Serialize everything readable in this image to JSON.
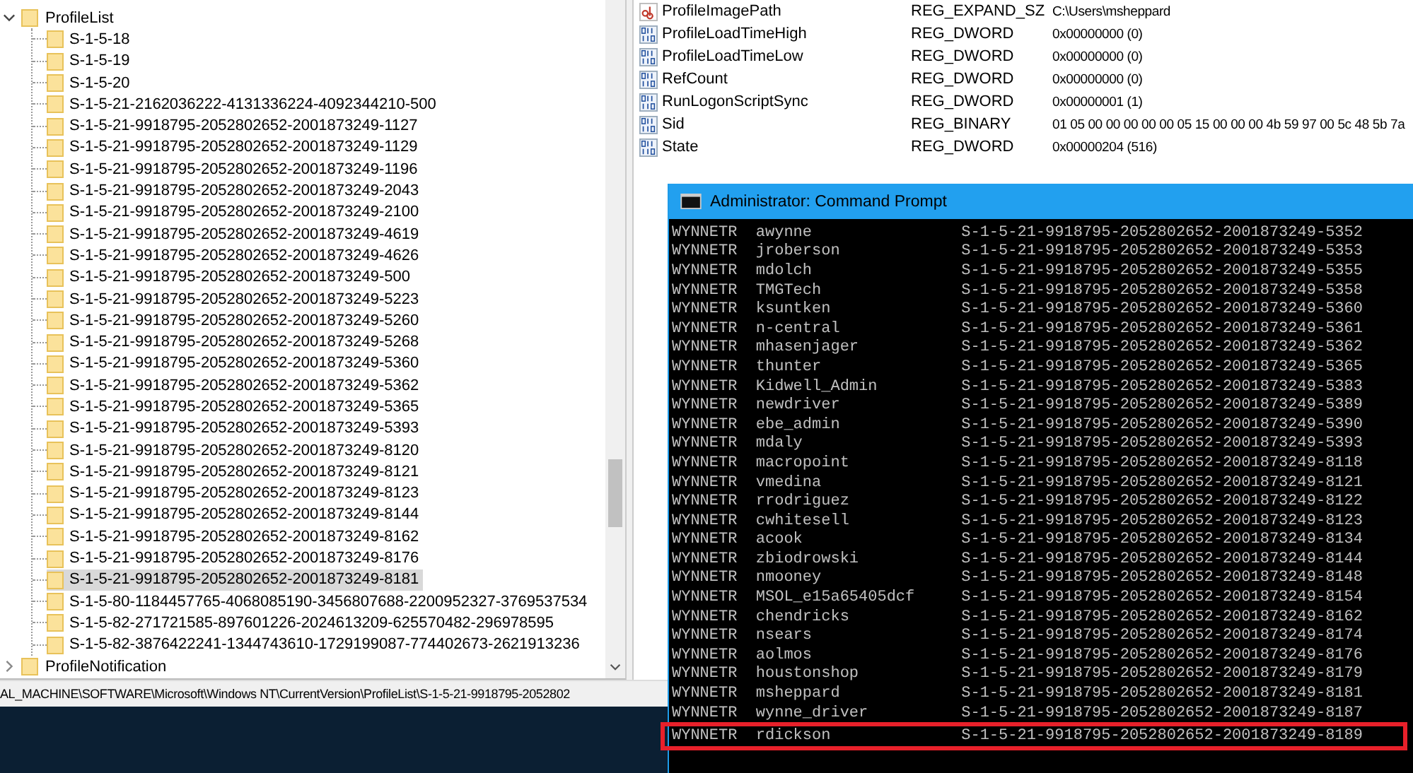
{
  "registry_editor": {
    "tree": [
      {
        "label": "ProfileList",
        "expanded": true,
        "children": [
          {
            "label": "S-1-5-18",
            "selected": false
          },
          {
            "label": "S-1-5-19",
            "selected": false
          },
          {
            "label": "S-1-5-20",
            "selected": false
          },
          {
            "label": "S-1-5-21-2162036222-4131336224-4092344210-500",
            "selected": false
          },
          {
            "label": "S-1-5-21-9918795-2052802652-2001873249-1127",
            "selected": false
          },
          {
            "label": "S-1-5-21-9918795-2052802652-2001873249-1129",
            "selected": false
          },
          {
            "label": "S-1-5-21-9918795-2052802652-2001873249-1196",
            "selected": false
          },
          {
            "label": "S-1-5-21-9918795-2052802652-2001873249-2043",
            "selected": false
          },
          {
            "label": "S-1-5-21-9918795-2052802652-2001873249-2100",
            "selected": false
          },
          {
            "label": "S-1-5-21-9918795-2052802652-2001873249-4619",
            "selected": false
          },
          {
            "label": "S-1-5-21-9918795-2052802652-2001873249-4626",
            "selected": false
          },
          {
            "label": "S-1-5-21-9918795-2052802652-2001873249-500",
            "selected": false
          },
          {
            "label": "S-1-5-21-9918795-2052802652-2001873249-5223",
            "selected": false
          },
          {
            "label": "S-1-5-21-9918795-2052802652-2001873249-5260",
            "selected": false
          },
          {
            "label": "S-1-5-21-9918795-2052802652-2001873249-5268",
            "selected": false
          },
          {
            "label": "S-1-5-21-9918795-2052802652-2001873249-5360",
            "selected": false
          },
          {
            "label": "S-1-5-21-9918795-2052802652-2001873249-5362",
            "selected": false
          },
          {
            "label": "S-1-5-21-9918795-2052802652-2001873249-5365",
            "selected": false
          },
          {
            "label": "S-1-5-21-9918795-2052802652-2001873249-5393",
            "selected": false
          },
          {
            "label": "S-1-5-21-9918795-2052802652-2001873249-8120",
            "selected": false
          },
          {
            "label": "S-1-5-21-9918795-2052802652-2001873249-8121",
            "selected": false
          },
          {
            "label": "S-1-5-21-9918795-2052802652-2001873249-8123",
            "selected": false
          },
          {
            "label": "S-1-5-21-9918795-2052802652-2001873249-8144",
            "selected": false
          },
          {
            "label": "S-1-5-21-9918795-2052802652-2001873249-8162",
            "selected": false
          },
          {
            "label": "S-1-5-21-9918795-2052802652-2001873249-8176",
            "selected": false
          },
          {
            "label": "S-1-5-21-9918795-2052802652-2001873249-8181",
            "selected": true
          },
          {
            "label": "S-1-5-80-1184457765-4068085190-3456807688-2200952327-3769537534",
            "selected": false
          },
          {
            "label": "S-1-5-82-271721585-897601226-2024613209-625570482-296978595",
            "selected": false
          },
          {
            "label": "S-1-5-82-3876422241-1344743610-1729199087-774402673-2621913236",
            "selected": false
          }
        ]
      },
      {
        "label": "ProfileNotification",
        "expanded": false
      }
    ],
    "values": [
      {
        "kind": "string",
        "name": "ProfileImagePath",
        "type": "REG_EXPAND_SZ",
        "data": "C:\\Users\\msheppard"
      },
      {
        "kind": "binary",
        "name": "ProfileLoadTimeHigh",
        "type": "REG_DWORD",
        "data": "0x00000000 (0)"
      },
      {
        "kind": "binary",
        "name": "ProfileLoadTimeLow",
        "type": "REG_DWORD",
        "data": "0x00000000 (0)"
      },
      {
        "kind": "binary",
        "name": "RefCount",
        "type": "REG_DWORD",
        "data": "0x00000000 (0)"
      },
      {
        "kind": "binary",
        "name": "RunLogonScriptSync",
        "type": "REG_DWORD",
        "data": "0x00000001 (1)"
      },
      {
        "kind": "binary",
        "name": "Sid",
        "type": "REG_BINARY",
        "data": "01 05 00 00 00 00 00 05 15 00 00 00 4b 59 97 00 5c 48 5b 7a"
      },
      {
        "kind": "binary",
        "name": "State",
        "type": "REG_DWORD",
        "data": "0x00000204 (516)"
      }
    ],
    "status_bar": "AL_MACHINE\\SOFTWARE\\Microsoft\\Windows NT\\CurrentVersion\\ProfileList\\S-1-5-21-9918795-2052802"
  },
  "command_prompt": {
    "title": "Administrator: Command Prompt",
    "rows": [
      {
        "domain": "WYNNETR",
        "user": "awynne",
        "sid": "S-1-5-21-9918795-2052802652-2001873249-5352",
        "highlighted": false
      },
      {
        "domain": "WYNNETR",
        "user": "jroberson",
        "sid": "S-1-5-21-9918795-2052802652-2001873249-5353",
        "highlighted": false
      },
      {
        "domain": "WYNNETR",
        "user": "mdolch",
        "sid": "S-1-5-21-9918795-2052802652-2001873249-5355",
        "highlighted": false
      },
      {
        "domain": "WYNNETR",
        "user": "TMGTech",
        "sid": "S-1-5-21-9918795-2052802652-2001873249-5358",
        "highlighted": false
      },
      {
        "domain": "WYNNETR",
        "user": "ksuntken",
        "sid": "S-1-5-21-9918795-2052802652-2001873249-5360",
        "highlighted": false
      },
      {
        "domain": "WYNNETR",
        "user": "n-central",
        "sid": "S-1-5-21-9918795-2052802652-2001873249-5361",
        "highlighted": false
      },
      {
        "domain": "WYNNETR",
        "user": "mhasenjager",
        "sid": "S-1-5-21-9918795-2052802652-2001873249-5362",
        "highlighted": false
      },
      {
        "domain": "WYNNETR",
        "user": "thunter",
        "sid": "S-1-5-21-9918795-2052802652-2001873249-5365",
        "highlighted": false
      },
      {
        "domain": "WYNNETR",
        "user": "Kidwell_Admin",
        "sid": "S-1-5-21-9918795-2052802652-2001873249-5383",
        "highlighted": false
      },
      {
        "domain": "WYNNETR",
        "user": "newdriver",
        "sid": "S-1-5-21-9918795-2052802652-2001873249-5389",
        "highlighted": false
      },
      {
        "domain": "WYNNETR",
        "user": "ebe_admin",
        "sid": "S-1-5-21-9918795-2052802652-2001873249-5390",
        "highlighted": false
      },
      {
        "domain": "WYNNETR",
        "user": "mdaly",
        "sid": "S-1-5-21-9918795-2052802652-2001873249-5393",
        "highlighted": false
      },
      {
        "domain": "WYNNETR",
        "user": "macropoint",
        "sid": "S-1-5-21-9918795-2052802652-2001873249-8118",
        "highlighted": false
      },
      {
        "domain": "WYNNETR",
        "user": "vmedina",
        "sid": "S-1-5-21-9918795-2052802652-2001873249-8121",
        "highlighted": false
      },
      {
        "domain": "WYNNETR",
        "user": "rrodriguez",
        "sid": "S-1-5-21-9918795-2052802652-2001873249-8122",
        "highlighted": false
      },
      {
        "domain": "WYNNETR",
        "user": "cwhitesell",
        "sid": "S-1-5-21-9918795-2052802652-2001873249-8123",
        "highlighted": false
      },
      {
        "domain": "WYNNETR",
        "user": "acook",
        "sid": "S-1-5-21-9918795-2052802652-2001873249-8134",
        "highlighted": false
      },
      {
        "domain": "WYNNETR",
        "user": "zbiodrowski",
        "sid": "S-1-5-21-9918795-2052802652-2001873249-8144",
        "highlighted": false
      },
      {
        "domain": "WYNNETR",
        "user": "nmooney",
        "sid": "S-1-5-21-9918795-2052802652-2001873249-8148",
        "highlighted": false
      },
      {
        "domain": "WYNNETR",
        "user": "MSOL_e15a65405dcf",
        "sid": "S-1-5-21-9918795-2052802652-2001873249-8154",
        "highlighted": false
      },
      {
        "domain": "WYNNETR",
        "user": "chendricks",
        "sid": "S-1-5-21-9918795-2052802652-2001873249-8162",
        "highlighted": false
      },
      {
        "domain": "WYNNETR",
        "user": "nsears",
        "sid": "S-1-5-21-9918795-2052802652-2001873249-8174",
        "highlighted": false
      },
      {
        "domain": "WYNNETR",
        "user": "aolmos",
        "sid": "S-1-5-21-9918795-2052802652-2001873249-8176",
        "highlighted": false
      },
      {
        "domain": "WYNNETR",
        "user": "houstonshop",
        "sid": "S-1-5-21-9918795-2052802652-2001873249-8179",
        "highlighted": false
      },
      {
        "domain": "WYNNETR",
        "user": "msheppard",
        "sid": "S-1-5-21-9918795-2052802652-2001873249-8181",
        "highlighted": false
      },
      {
        "domain": "WYNNETR",
        "user": "wynne_driver",
        "sid": "S-1-5-21-9918795-2052802652-2001873249-8187",
        "highlighted": false
      },
      {
        "domain": "WYNNETR",
        "user": "rdickson",
        "sid": "S-1-5-21-9918795-2052802652-2001873249-8189",
        "highlighted": true
      }
    ]
  }
}
